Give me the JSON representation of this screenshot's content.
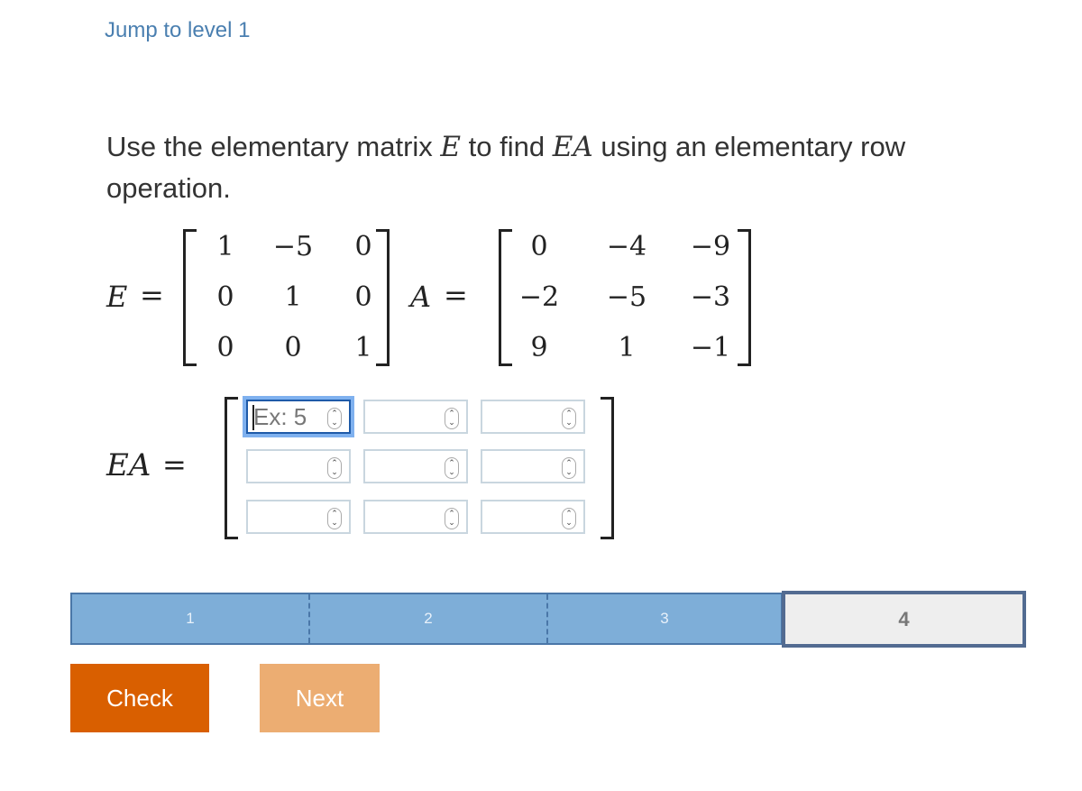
{
  "header": {
    "jump_link": "Jump to level 1"
  },
  "prompt": {
    "text_1": "Use the elementary matrix ",
    "var_E": "E",
    "text_2": " to find ",
    "var_EA": "EA",
    "text_3": " using an elementary row operation."
  },
  "matrix_E": {
    "label": "E",
    "equals": "=",
    "rows": [
      [
        "1",
        "−5",
        "0"
      ],
      [
        "0",
        "1",
        "0"
      ],
      [
        "0",
        "0",
        "1"
      ]
    ]
  },
  "matrix_A": {
    "label": "A",
    "equals": "=",
    "rows": [
      [
        "0",
        "−4",
        "−9"
      ],
      [
        "−2",
        "−5",
        "−3"
      ],
      [
        "9",
        "1",
        "−1"
      ]
    ]
  },
  "answer": {
    "label": "EA",
    "equals": "=",
    "placeholder": "Ex: 5",
    "rows": [
      [
        "",
        "",
        ""
      ],
      [
        "",
        "",
        ""
      ],
      [
        "",
        "",
        ""
      ]
    ],
    "spinner_up": "⌃",
    "spinner_down": "⌄"
  },
  "progress": {
    "levels": [
      "1",
      "2",
      "3",
      "4"
    ],
    "completed": 3,
    "current": "4",
    "colors": {
      "completed": "#7eaed8",
      "current_border": "#526b91",
      "current_bg": "#eeeeee"
    }
  },
  "buttons": {
    "check": "Check",
    "next": "Next"
  },
  "colors": {
    "check": "#d95f00",
    "next": "#ecad72",
    "link": "#4a7fb0"
  }
}
